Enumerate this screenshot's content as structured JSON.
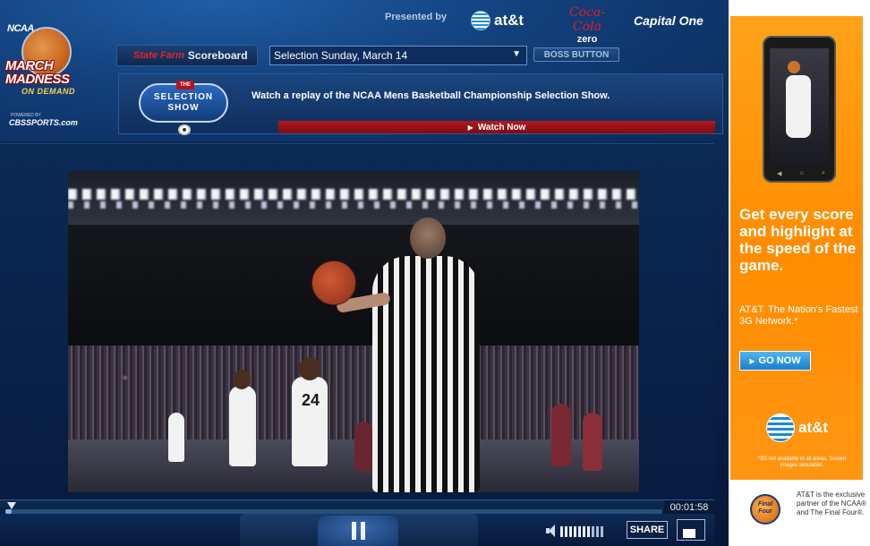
{
  "logo": {
    "ncaa": "NCAA",
    "line1": "MARCH",
    "line2": "MADNESS",
    "line3": "ON DEMAND",
    "powered_by": "POWERED BY",
    "cbs": "CBSSPORTS.com"
  },
  "sponsors": {
    "presented_by": "Presented by",
    "att": "at&t",
    "coke_line1": "Coca-Cola",
    "coke_line2": "zero",
    "capital_one": "Capital One"
  },
  "scoreboard": {
    "brand": "State Farm",
    "label": "Scoreboard",
    "selected_option": "Selection Sunday, March 14",
    "boss_button": "BOSS BUTTON"
  },
  "promo": {
    "badge_the": "THE",
    "badge_line1": "SELECTION",
    "badge_line2": "SHOW",
    "text": "Watch a replay of the NCAA Mens Basketball Championship Selection Show.",
    "watch_now": "Watch Now"
  },
  "video": {
    "jersey_number": "24"
  },
  "player": {
    "time": "00:01:58",
    "progress": 0.01,
    "volume_level": 0.7,
    "share_label": "SHARE"
  },
  "ad": {
    "headline": "Get every score and highlight at the speed of the game.",
    "subhead": "AT&T. The Nation's Fastest 3G Network.*",
    "go_button": "GO NOW",
    "brand": "at&t",
    "fine_print": "*3G not available in all areas. Screen images simulated."
  },
  "partner": {
    "logo_text": "Final Four",
    "text": "AT&T is the exclusive partner of the NCAA® and The Final Four®."
  },
  "colors": {
    "background": "#0b1f3f",
    "accent_red": "#b01a20",
    "ad_orange": "#ff8c00",
    "att_blue": "#1a8ad6"
  },
  "icons": {
    "play_pause": "pause-icon",
    "volume": "speaker-icon",
    "fullscreen": "fullscreen-icon",
    "watch_arrow": "play-triangle-icon",
    "dropdown": "chevron-down-icon"
  }
}
